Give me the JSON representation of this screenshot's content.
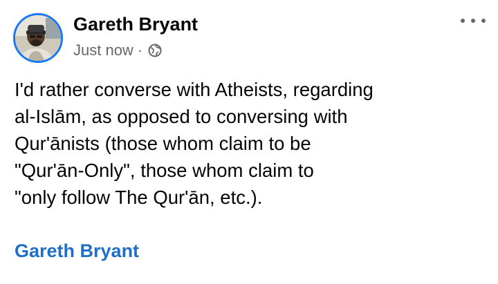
{
  "post": {
    "author": "Gareth Bryant",
    "timestamp": "Just now",
    "separator": "·",
    "audience_icon": "globe-icon",
    "menu_icon": "more-options-icon",
    "body_lines": [
      "I'd rather converse with Atheists, regarding",
      "al-Islām, as opposed to conversing with",
      "Qur'ānists (those whom claim to be",
      "\"Qur'ān-Only\", those whom claim to",
      "\"only follow The Qur'ān, etc.)."
    ],
    "signature": "Gareth Bryant"
  },
  "colors": {
    "text": "#050505",
    "muted": "#65676b",
    "link": "#1f6fc8",
    "avatar_ring": "#1877f2"
  }
}
